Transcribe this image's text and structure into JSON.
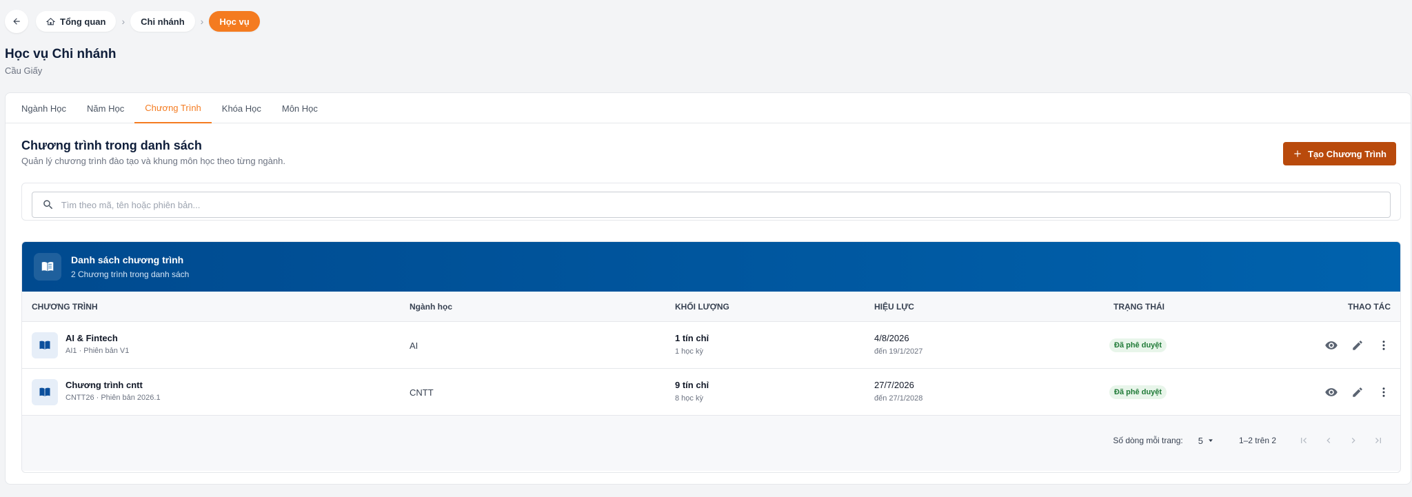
{
  "breadcrumb": {
    "items": [
      {
        "label": "Tổng quan",
        "icon": "home-icon"
      },
      {
        "label": "Chi nhánh"
      },
      {
        "label": "Học vụ"
      }
    ]
  },
  "page": {
    "title": "Học vụ Chi nhánh",
    "subtitle": "Cầu Giấy"
  },
  "tabs": [
    {
      "label": "Ngành Học"
    },
    {
      "label": "Năm Học"
    },
    {
      "label": "Chương Trình",
      "active": true
    },
    {
      "label": "Khóa Học"
    },
    {
      "label": "Môn Học"
    }
  ],
  "section": {
    "title": "Chương trình trong danh sách",
    "description": "Quản lý chương trình đào tạo và khung môn học theo từng ngành.",
    "create_label": "Tạo Chương Trình"
  },
  "search": {
    "placeholder": "Tìm theo mã, tên hoặc phiên bản...",
    "value": ""
  },
  "table": {
    "banner_title": "Danh sách chương trình",
    "banner_subtitle": "2 Chương trình trong danh sách",
    "columns": [
      "CHƯƠNG TRÌNH",
      "Ngành học",
      "KHỐI LƯỢNG",
      "HIỆU LỰC",
      "TRẠNG THÁI",
      "THAO TÁC"
    ],
    "rows": [
      {
        "name": "AI & Fintech",
        "meta": "AI1 · Phiên bản V1",
        "major": "AI",
        "credits": "1 tín chỉ",
        "semesters": "1 học kỳ",
        "start": "4/8/2026",
        "until": "đến 19/1/2027",
        "status": "Đã phê duyệt"
      },
      {
        "name": "Chương trình cntt",
        "meta": "CNTT26 · Phiên bản 2026.1",
        "major": "CNTT",
        "credits": "9 tín chỉ",
        "semesters": "8 học kỳ",
        "start": "27/7/2026",
        "until": "đến 27/1/2028",
        "status": "Đã phê duyệt"
      }
    ]
  },
  "pagination": {
    "rows_per_page_label": "Số dòng mỗi trang:",
    "rows_per_page": "5",
    "range": "1–2 trên 2"
  },
  "colors": {
    "accent": "#f47b20",
    "primary_button": "#b94a0c",
    "banner": "#0059a3",
    "status_approved": "#1f7a37"
  }
}
